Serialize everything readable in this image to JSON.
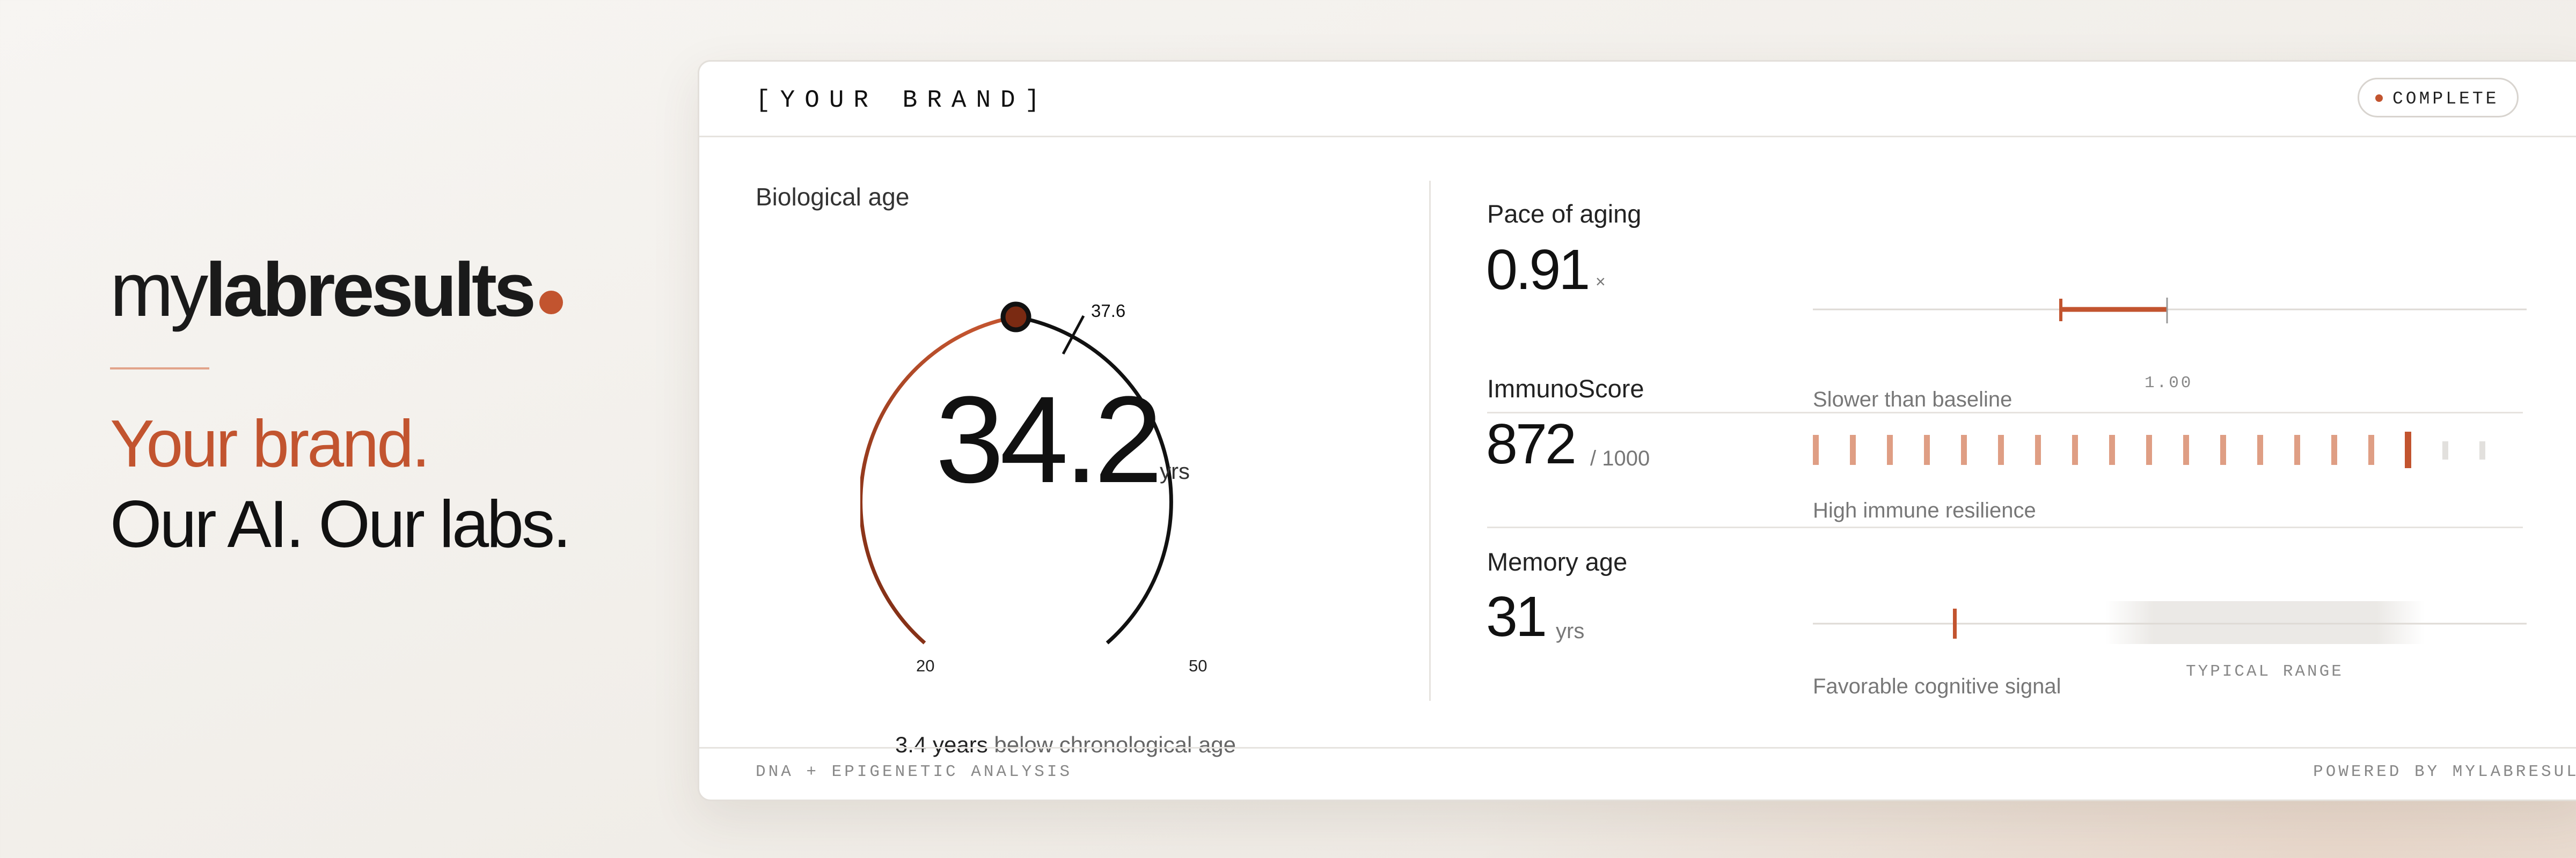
{
  "hero": {
    "logo_light": "my",
    "logo_bold": "labresults",
    "tagline_1": "Your brand.",
    "tagline_2": "Our AI. Our labs."
  },
  "card": {
    "brand": "[YOUR BRAND]",
    "status": "COMPLETE",
    "footer_left": "DNA + EPIGENETIC ANALYSIS",
    "footer_right": "POWERED BY MYLABRESULTS"
  },
  "biological_age": {
    "title": "Biological age",
    "value": "34.2",
    "unit": "yrs",
    "reference": "37.6",
    "scale_min": "20",
    "scale_max": "50",
    "caption_bold": "3.4 years",
    "caption_rest": " below chronological age"
  },
  "pace_of_aging": {
    "title": "Pace of aging",
    "value": "0.91",
    "unit": "×",
    "baseline": "1.00",
    "caption": "Slower than baseline"
  },
  "immunoscore": {
    "title": "ImmunoScore",
    "value": "872",
    "unit": "/ 1000",
    "caption": "High immune resilience"
  },
  "memory_age": {
    "title": "Memory age",
    "value": "31",
    "unit": "yrs",
    "range_label": "TYPICAL RANGE",
    "caption": "Favorable cognitive signal"
  },
  "colors": {
    "accent": "#c2542f",
    "accent_dark": "#7a2a12",
    "background": "#f4f1ed"
  }
}
